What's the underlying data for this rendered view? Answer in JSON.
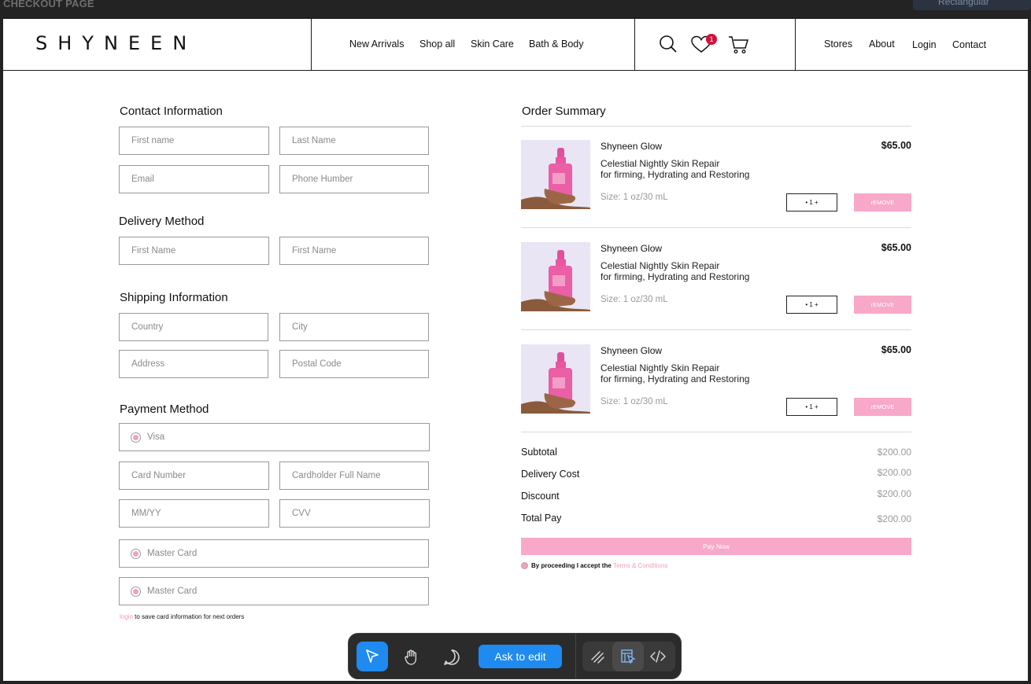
{
  "frame": {
    "label": "CHECKOUT PAGE",
    "top_right_label": "Rectangular"
  },
  "brand": {
    "logo": "SHYNEEN",
    "accent": "#f8a8c8",
    "badge_color": "#d3123a"
  },
  "nav": {
    "items": [
      "New Arrivals",
      "Shop all",
      "Skin Care",
      "Bath & Body"
    ]
  },
  "header_icons": {
    "search": "search-icon",
    "wishlist": "heart-icon",
    "cart": "cart-icon",
    "wishlist_count": "1"
  },
  "right_nav": {
    "items": [
      "Stores",
      "About",
      "Login",
      "Contact"
    ]
  },
  "contact": {
    "title": "Contact Information",
    "first_name": "First name",
    "last_name": "Last Name",
    "email": "Email",
    "phone": "Phone Humber"
  },
  "delivery": {
    "title": "Delivery Method",
    "field1": "First Name",
    "field2": "First Name"
  },
  "shipping": {
    "title": "Shipping Information",
    "country": "Country",
    "city": "City",
    "address": "Address",
    "postal": "Postal Code"
  },
  "payment": {
    "title": "Payment Method",
    "visa": "Visa",
    "card_number": "Card Number",
    "cardholder": "Cardholder Full Name",
    "expiry": "MM/YY",
    "cvv": "CVV",
    "master1": "Master Card",
    "master2": "Master Card",
    "login_link": "login",
    "save_note": " to save card information for next orders"
  },
  "summary": {
    "title": "Order Summary",
    "items": [
      {
        "name": "Shyneen Glow",
        "desc1": "Celestial Nightly Skin Repair",
        "desc2": "for firming, Hydrating and Restoring",
        "size": "Size: 1 oz/30 mL",
        "price": "$65.00",
        "qty": "• 1 +",
        "remove": "rEMOVE"
      },
      {
        "name": "Shyneen Glow",
        "desc1": "Celestial Nightly Skin Repair",
        "desc2": "for firming, Hydrating and Restoring",
        "size": "Size: 1 oz/30 mL",
        "price": "$65.00",
        "qty": "• 1 +",
        "remove": "rEMOVE"
      },
      {
        "name": "Shyneen Glow",
        "desc1": "Celestial Nightly Skin Repair",
        "desc2": "for firming, Hydrating and Restoring",
        "size": "Size: 1 oz/30 mL",
        "price": "$65.00",
        "qty": "• 1 +",
        "remove": "rEMOVE"
      }
    ],
    "subtotal_label": "Subtotal",
    "subtotal": "$200.00",
    "delivery_label": "Delivery Cost",
    "delivery": "$200.00",
    "discount_label": "Discount",
    "discount": "$200.00",
    "total_label": "Total Pay",
    "total": "$200.00",
    "pay_now": "Pay Now",
    "terms_prefix": "By proceeding I accept the ",
    "terms_link": "Terms & Conditions"
  },
  "toolbar": {
    "select": "cursor-arrow-icon",
    "hand": "hand-icon",
    "comment": "comment-icon",
    "ask_to_edit": "Ask to edit",
    "draw": "draw-icon",
    "dev_mode": "dev-mode-icon",
    "code": "code-icon"
  }
}
